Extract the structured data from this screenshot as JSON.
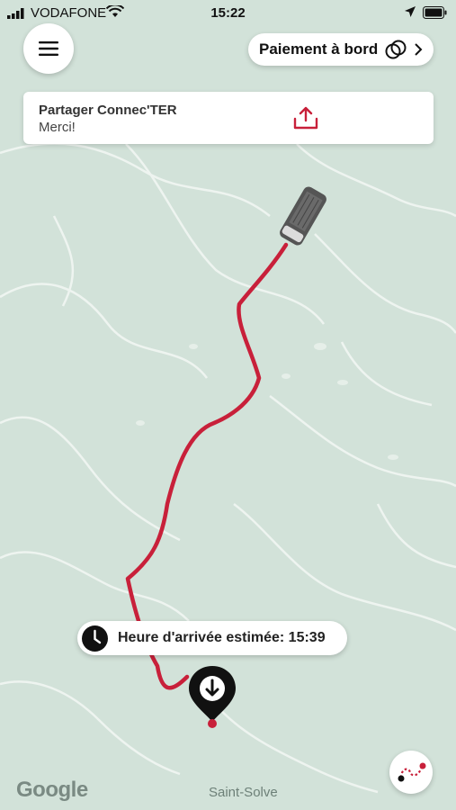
{
  "status_bar": {
    "carrier": "VODAFONE",
    "time": "15:22"
  },
  "header": {
    "menu_icon": "hamburger-icon",
    "payment_label": "Paiement à bord",
    "payment_icon": "coins-icon"
  },
  "share": {
    "title": "Partager Connec'TER",
    "subtitle": "Merci!",
    "icon": "share-upload-icon"
  },
  "eta": {
    "text": "Heure d'arrivée estimée: 15:39",
    "icon": "clock-icon"
  },
  "map": {
    "place_label": "Saint-Solve",
    "attribution": "Google",
    "route_color": "#c8203a",
    "train_icon": "train-icon",
    "destination_icon": "destination-pin-icon"
  },
  "actions": {
    "route_icon": "route-icon"
  }
}
